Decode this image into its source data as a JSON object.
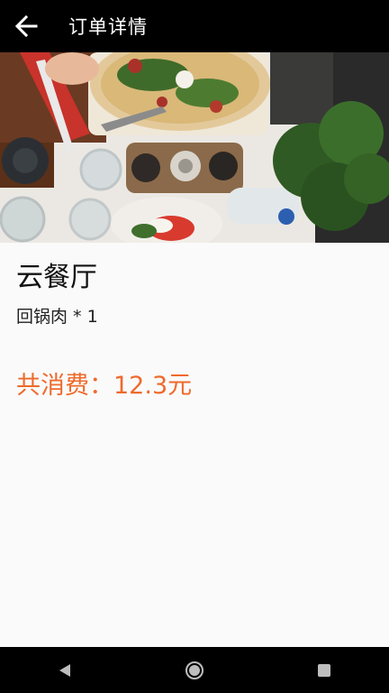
{
  "appbar": {
    "title": "订单详情",
    "back_icon": "arrow-left-icon"
  },
  "hero": {
    "image_icon": "food-photo"
  },
  "order": {
    "restaurant_name": "云餐厅",
    "item_line": "回锅肉 * 1",
    "total_text": "共消费：12.3元"
  },
  "colors": {
    "appbar_bg": "#000000",
    "accent_price": "#ee6a2c",
    "page_bg": "#fafafa"
  },
  "navbar": {
    "back_icon": "nav-back-triangle-icon",
    "home_icon": "nav-home-circle-icon",
    "recents_icon": "nav-recents-square-icon"
  }
}
